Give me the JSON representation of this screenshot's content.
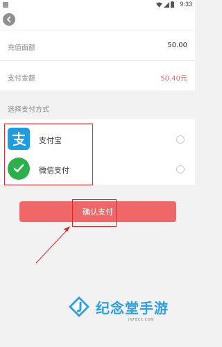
{
  "status_bar": {
    "time": "9:33"
  },
  "header": {
    "back_icon": "chevron-left-icon"
  },
  "recharge": {
    "label": "充值面额",
    "value": "50.00"
  },
  "payment": {
    "label": "支付金额",
    "value": "50.40元",
    "color": "#f06464"
  },
  "methods": {
    "section_title": "选择支付方式",
    "items": [
      {
        "label": "支付宝",
        "icon": "alipay-icon",
        "color": "#1d9de0"
      },
      {
        "label": "微信支付",
        "icon": "wechat-pay-icon",
        "color": "#2bb04c"
      }
    ]
  },
  "confirm": {
    "label": "确认支付",
    "color": "#f06767"
  },
  "watermark": {
    "text": "纪念堂手游",
    "sub": "JNTBCC.COM"
  },
  "annotation": {
    "color": "#e4252a"
  }
}
